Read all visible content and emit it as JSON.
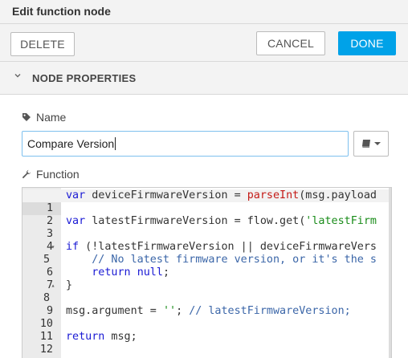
{
  "title": "Edit function node",
  "toolbar": {
    "delete_label": "DELETE",
    "cancel_label": "CANCEL",
    "done_label": "DONE"
  },
  "section": {
    "title": "NODE PROPERTIES"
  },
  "name_field": {
    "label": "Name",
    "value": "Compare Version"
  },
  "function_field": {
    "label": "Function"
  },
  "icons": {
    "section_toggle": "chevron-down-icon",
    "name_label": "tag-icon",
    "function_label": "wrench-icon",
    "library": "book-icon",
    "library_dropdown": "caret-down-icon"
  },
  "colors": {
    "accent": "#00a2e8",
    "keyword": "#1a1ad4",
    "function": "#c41a16",
    "string": "#1a8c1a",
    "comment": "#3b66a8"
  },
  "code": {
    "line_numbers": [
      "1",
      "2",
      "3",
      "4",
      "5",
      "6",
      "7",
      "8",
      "9",
      "10",
      "11",
      "12"
    ],
    "fold_markers": {
      "5": "▾",
      "8": "▴"
    },
    "l1a": "var",
    "l1b": " deviceFirmwareVersion = ",
    "l1c": "parseInt",
    "l1d": "(msg.payload",
    "l3a": "var",
    "l3b": " latestFirmwareVersion = flow.get(",
    "l3c": "'latestFirm",
    "l5a": "if",
    "l5b": " (!latestFirmwareVersion || deviceFirmwareVers",
    "l6a": "    ",
    "l6b": "// No latest firmware version, or it's the s",
    "l7a": "    ",
    "l7b": "return",
    "l7c": " ",
    "l7d": "null",
    "l7e": ";",
    "l8a": "}",
    "l10a": "msg.argument = ",
    "l10b": "''",
    "l10c": "; ",
    "l10d": "// latestFirmwareVersion;",
    "l12a": "return",
    "l12b": " msg;"
  }
}
